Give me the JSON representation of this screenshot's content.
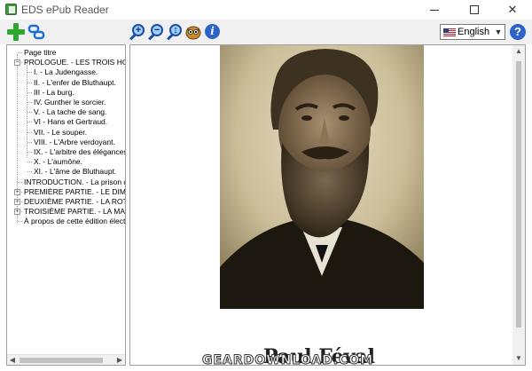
{
  "window": {
    "title": "EDS ePub Reader"
  },
  "toolbar": {
    "add_icon": "plus-icon",
    "link_icon": "link-icon",
    "zoom_in_symbol": "+",
    "zoom_out_symbol": "−",
    "zoom_fit_symbol": "↕",
    "owl_icon": "owl-icon",
    "info_symbol": "i"
  },
  "language": {
    "selected": "English"
  },
  "help": {
    "symbol": "?"
  },
  "toc": {
    "items": [
      {
        "label": "Page titre",
        "toggle": ""
      },
      {
        "label": "PROLOGUE. - LES TROIS HOMMES",
        "toggle": "−"
      },
      {
        "label": "I. - La Judengasse.",
        "toggle": ""
      },
      {
        "label": "II. - L'enfer de Bluthaupt.",
        "toggle": ""
      },
      {
        "label": "III - La burg.",
        "toggle": ""
      },
      {
        "label": "IV. Gunther le sorcier.",
        "toggle": ""
      },
      {
        "label": "V. - La tache de sang.",
        "toggle": ""
      },
      {
        "label": "VI - Hans et Gertraud.",
        "toggle": ""
      },
      {
        "label": "VII. - Le souper.",
        "toggle": ""
      },
      {
        "label": "VIII. - L'Arbre verdoyant.",
        "toggle": ""
      },
      {
        "label": "IX. - L'arbitre des élégances.",
        "toggle": ""
      },
      {
        "label": "X. - L'aumône.",
        "toggle": ""
      },
      {
        "label": "XI. - L'âme de Bluthaupt.",
        "toggle": ""
      },
      {
        "label": "INTRODUCTION. - La prison de Francfort",
        "toggle": ""
      },
      {
        "label": "PREMIÈRE PARTIE. - LE DIMANCHE",
        "toggle": "+"
      },
      {
        "label": "DEUXIÈME PARTIE. - LA ROTONDE",
        "toggle": "+"
      },
      {
        "label": "TROISIÈME PARTIE. - LA MAISON",
        "toggle": "+"
      },
      {
        "label": "À propos de cette édition électronique",
        "toggle": ""
      }
    ]
  },
  "content": {
    "heading": "Paul Féval"
  },
  "watermark": {
    "text": "GEARDOWNLOAD.COM"
  },
  "colors": {
    "accent": "#2d62c8",
    "add": "#2fa82f",
    "sepia_dark": "#2a2216",
    "sepia_light": "#d9cfb2"
  }
}
